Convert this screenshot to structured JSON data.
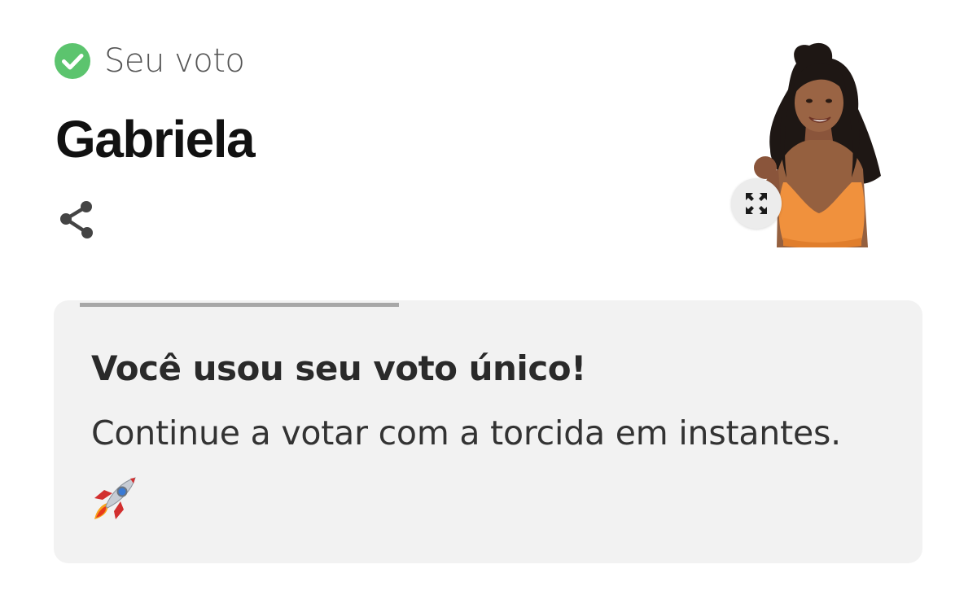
{
  "vote": {
    "status_label": "Seu voto",
    "candidate_name": "Gabriela",
    "status_color": "#5cc46e"
  },
  "photo": {
    "alt": "Gabriela"
  },
  "message": {
    "title": "Você usou seu voto único!",
    "text": "Continue a votar com a torcida em instantes.",
    "emoji_icon": "rocket-icon"
  },
  "icons": {
    "check": "check-circle-icon",
    "share": "share-icon",
    "expand": "expand-icon"
  }
}
